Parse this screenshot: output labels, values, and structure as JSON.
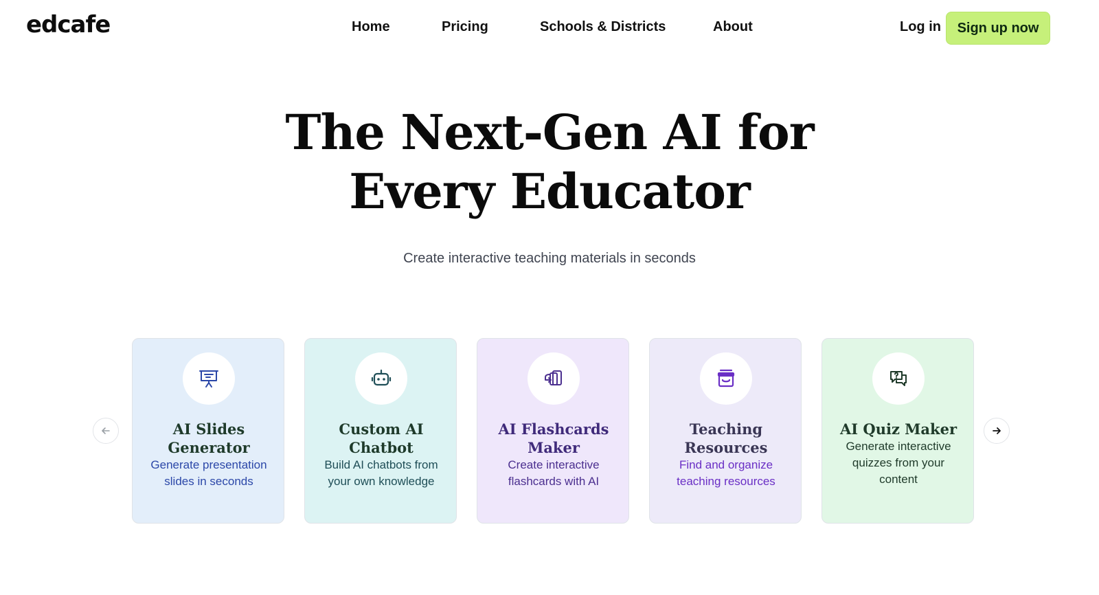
{
  "header": {
    "logo": "edcafe",
    "nav": [
      "Home",
      "Pricing",
      "Schools & Districts",
      "About"
    ],
    "login_label": "Log in",
    "signup_label": "Sign up now"
  },
  "hero": {
    "title_line1": "The Next-Gen AI for",
    "title_line2": "Every Educator",
    "subtitle": "Create interactive teaching materials in seconds"
  },
  "carousel": {
    "prev_icon": "arrow-left-icon",
    "next_icon": "arrow-right-icon",
    "cards": [
      {
        "icon": "presentation-icon",
        "title_line1": "AI Slides",
        "title_line2": "Generator",
        "desc_line1": "Generate presentation",
        "desc_line2": "slides in seconds",
        "bg": "#e3eefa",
        "accent": "#2b47a8",
        "title_color": "#1e3a2a"
      },
      {
        "icon": "robot-icon",
        "title_line1": "Custom AI",
        "title_line2": "Chatbot",
        "desc_line1": "Build AI chatbots from",
        "desc_line2": "your own knowledge",
        "bg": "#dcf3f3",
        "accent": "#1f4e57",
        "title_color": "#1e3a2a"
      },
      {
        "icon": "flashcards-icon",
        "title_line1": "AI Flashcards",
        "title_line2": "Maker",
        "desc_line1": "Create interactive",
        "desc_line2": "flashcards with AI",
        "bg": "#efe7fb",
        "accent": "#4b2f8f",
        "title_color": "#3f2a7a"
      },
      {
        "icon": "archive-box-icon",
        "title_line1": "Teaching",
        "title_line2": "Resources",
        "desc_line1": "Find and organize",
        "desc_line2": "teaching resources",
        "bg": "#edeaf9",
        "accent": "#6a2fc5",
        "title_color": "#3a3655"
      },
      {
        "icon": "quiz-chat-icon",
        "title_line1": "AI Quiz Maker",
        "title_line2": "",
        "desc_line1": "Generate interactive",
        "desc_line2": "quizzes from your",
        "desc_line3": "content",
        "bg": "#e1f7e6",
        "accent": "#1f3a2a",
        "title_color": "#1f3a2a"
      }
    ]
  }
}
